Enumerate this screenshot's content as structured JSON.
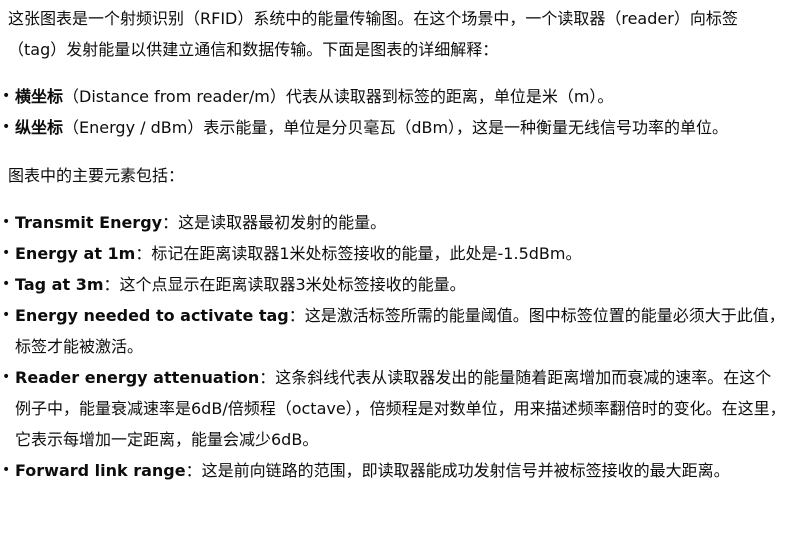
{
  "intro": "这张图表是一个射频识别（RFID）系统中的能量传输图。在这个场景中，一个读取器（reader）向标签（tag）发射能量以供建立通信和数据传输。下面是图表的详细解释：",
  "axes": [
    {
      "term": "横坐标",
      "text": "（Distance from reader/m）代表从读取器到标签的距离，单位是米（m）。"
    },
    {
      "term": "纵坐标",
      "text": "（Energy / dBm）表示能量，单位是分贝毫瓦（dBm），这是一种衡量无线信号功率的单位。"
    }
  ],
  "elements_heading": "图表中的主要元素包括：",
  "elements": [
    {
      "term": "Transmit Energy",
      "text": "：这是读取器最初发射的能量。"
    },
    {
      "term": "Energy at 1m",
      "text": "：标记在距离读取器1米处标签接收的能量，此处是-1.5dBm。"
    },
    {
      "term": "Tag at 3m",
      "text": "：这个点显示在距离读取器3米处标签接收的能量。"
    },
    {
      "term": "Energy needed to activate tag",
      "text": "：这是激活标签所需的能量阈值。图中标签位置的能量必须大于此值，标签才能被激活。"
    },
    {
      "term": "Reader energy attenuation",
      "text": "：这条斜线代表从读取器发出的能量随着距离增加而衰减的速率。在这个例子中，能量衰减速率是6dB/倍频程（octave），倍频程是对数单位，用来描述频率翻倍时的变化。在这里，它表示每增加一定距离，能量会减少6dB。"
    },
    {
      "term": "Forward link range",
      "text": "：这是前向链路的范围，即读取器能成功发射信号并被标签接收的最大距离。"
    }
  ]
}
